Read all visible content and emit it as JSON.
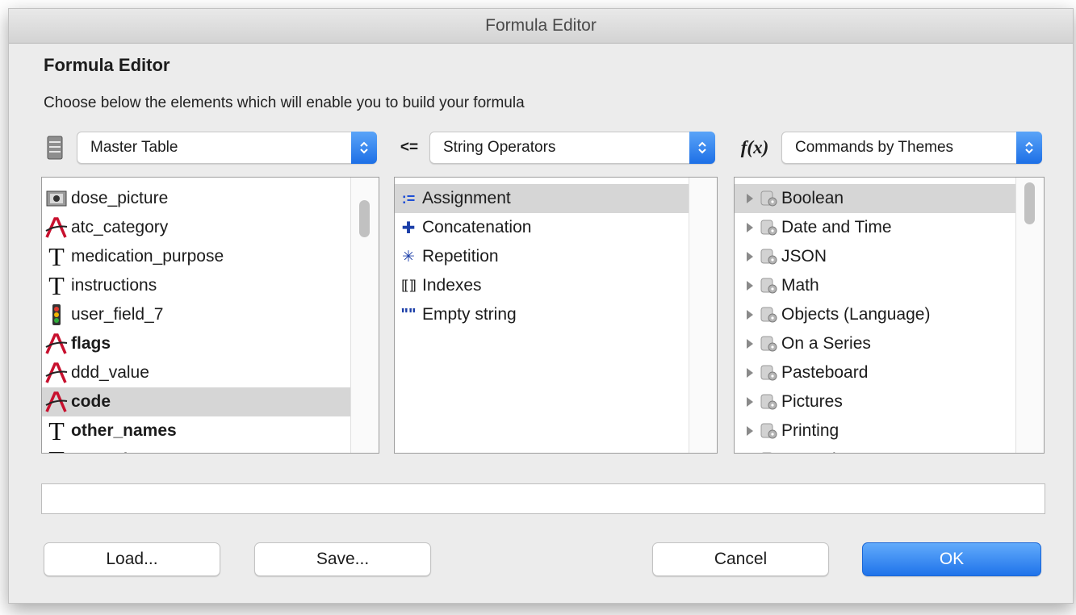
{
  "window": {
    "title": "Formula Editor"
  },
  "heading": "Formula Editor",
  "subtitle": "Choose below the elements which will enable you to build your formula",
  "tables": {
    "dropdown_label": "Master Table",
    "fields": [
      {
        "label": "dose_picture",
        "icon": "picture-field-icon",
        "bold": false,
        "selected": false
      },
      {
        "label": "atc_category",
        "icon": "alpha-field-icon",
        "bold": false,
        "selected": false
      },
      {
        "label": "medication_purpose",
        "icon": "text-field-icon",
        "bold": false,
        "selected": false
      },
      {
        "label": "instructions",
        "icon": "text-field-icon",
        "bold": false,
        "selected": false
      },
      {
        "label": "user_field_7",
        "icon": "boolean-field-icon",
        "bold": false,
        "selected": false
      },
      {
        "label": "flags",
        "icon": "alpha-field-icon",
        "bold": true,
        "selected": false
      },
      {
        "label": "ddd_value",
        "icon": "alpha-field-icon",
        "bold": false,
        "selected": false
      },
      {
        "label": "code",
        "icon": "alpha-field-icon",
        "bold": true,
        "selected": true
      },
      {
        "label": "other_names",
        "icon": "text-field-icon",
        "bold": true,
        "selected": false
      },
      {
        "label": "type_of",
        "icon": "text-field-icon",
        "bold": false,
        "selected": false
      }
    ]
  },
  "operators": {
    "icon_text": "<=",
    "dropdown_label": "String Operators",
    "items": [
      {
        "label": "Assignment",
        "icon": "assignment-icon",
        "glyph": ":=",
        "selected": true
      },
      {
        "label": "Concatenation",
        "icon": "plus-icon",
        "glyph": "✚",
        "selected": false
      },
      {
        "label": "Repetition",
        "icon": "asterisk-icon",
        "glyph": "✳",
        "selected": false
      },
      {
        "label": "Indexes",
        "icon": "brackets-icon",
        "glyph": "[[ ]]",
        "selected": false
      },
      {
        "label": "Empty string",
        "icon": "empty-string-icon",
        "glyph": "\"\"",
        "selected": false
      }
    ]
  },
  "commands": {
    "icon_text": "f(x)",
    "dropdown_label": "Commands by Themes",
    "themes": [
      {
        "label": "Boolean",
        "selected": true
      },
      {
        "label": "Date and Time",
        "selected": false
      },
      {
        "label": "JSON",
        "selected": false
      },
      {
        "label": "Math",
        "selected": false
      },
      {
        "label": "Objects (Language)",
        "selected": false
      },
      {
        "label": "On a Series",
        "selected": false
      },
      {
        "label": "Pasteboard",
        "selected": false
      },
      {
        "label": "Pictures",
        "selected": false
      },
      {
        "label": "Printing",
        "selected": false
      },
      {
        "label": "Records",
        "selected": false
      }
    ]
  },
  "formula": {
    "value": ""
  },
  "buttons": {
    "load": "Load...",
    "save": "Save...",
    "cancel": "Cancel",
    "ok": "OK"
  },
  "colors": {
    "accent": "#1f73ea",
    "selection": "#d6d6d6"
  }
}
